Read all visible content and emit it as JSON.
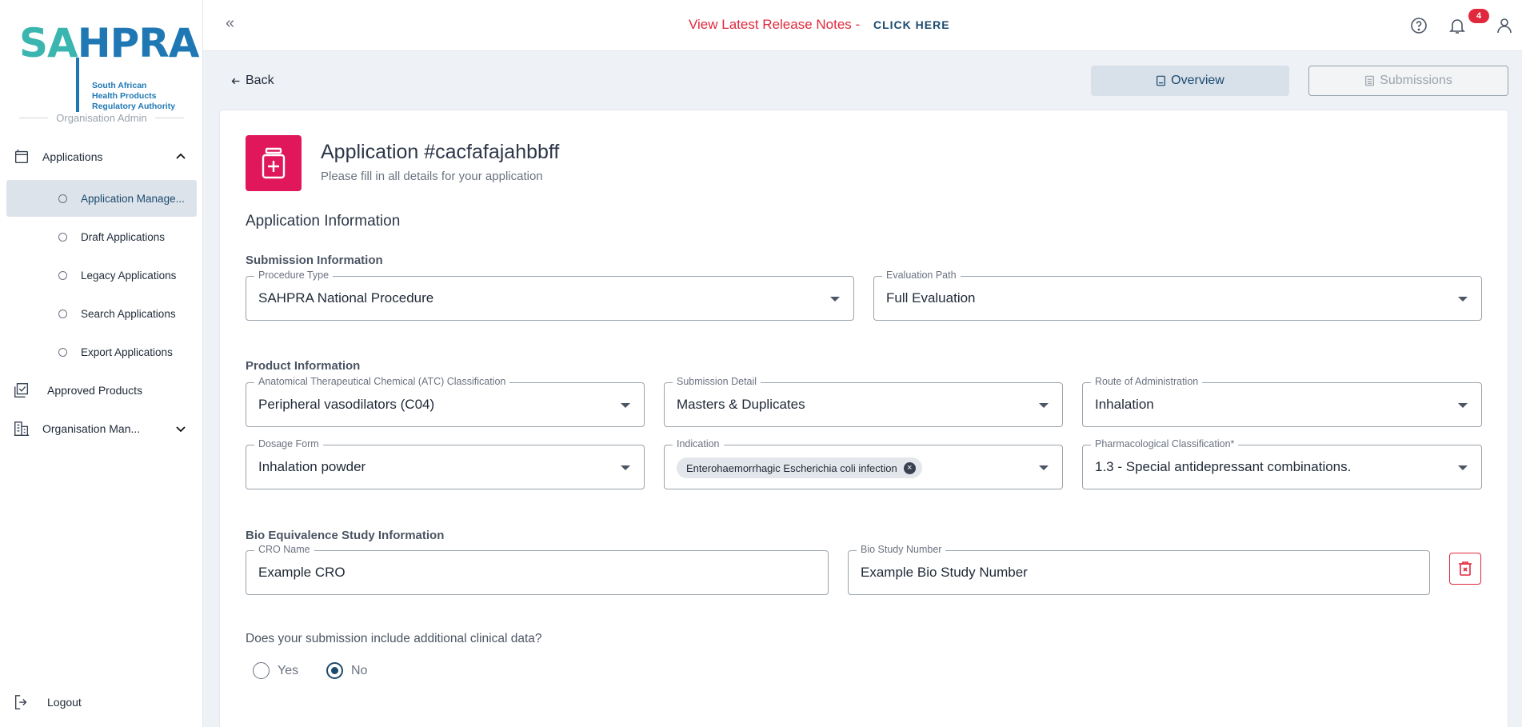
{
  "logo": {
    "brand_sa": "SA",
    "brand_hpra": "HPRA",
    "tagline_1": "South African",
    "tagline_2": "Health Products",
    "tagline_3": "Regulatory Authority"
  },
  "sidebar": {
    "section_label": "Organisation Admin",
    "applications": "Applications",
    "sub_items": [
      "Application Manage...",
      "Draft Applications",
      "Legacy Applications",
      "Search Applications",
      "Export Applications"
    ],
    "approved_products": "Approved Products",
    "organisation": "Organisation Man...",
    "logout": "Logout"
  },
  "topbar": {
    "collapse": "«",
    "release_notes": "View Latest Release Notes -",
    "click_here": "CLICK HERE",
    "notification_count": "4"
  },
  "subheader": {
    "back": "Back",
    "overview": "Overview",
    "submissions": "Submissions"
  },
  "application": {
    "title": "Application #cacfafajahbbff",
    "subtitle": "Please fill in all details for your application",
    "section": "Application Information"
  },
  "submission_info": {
    "title": "Submission Information",
    "procedure_type": {
      "label": "Procedure Type",
      "value": "SAHPRA National Procedure"
    },
    "evaluation_path": {
      "label": "Evaluation Path",
      "value": "Full Evaluation"
    }
  },
  "product_info": {
    "title": "Product Information",
    "atc": {
      "label": "Anatomical Therapeutical Chemical (ATC) Classification",
      "value": "Peripheral vasodilators (C04)"
    },
    "submission_detail": {
      "label": "Submission Detail",
      "value": "Masters & Duplicates"
    },
    "route": {
      "label": "Route of Administration",
      "value": "Inhalation"
    },
    "dosage_form": {
      "label": "Dosage Form",
      "value": "Inhalation powder"
    },
    "indication": {
      "label": "Indication",
      "chip": "Enterohaemorrhagic Escherichia coli infection"
    },
    "pharmacological": {
      "label": "Pharmacological Classification*",
      "value": "1.3 - Special antidepressant combinations."
    }
  },
  "bio_info": {
    "title": "Bio Equivalence Study Information",
    "cro_name": {
      "label": "CRO Name",
      "value": "Example CRO"
    },
    "bio_study_number": {
      "label": "Bio Study Number",
      "value": "Example Bio Study Number"
    }
  },
  "clinical": {
    "question": "Does your submission include additional clinical data?",
    "yes": "Yes",
    "no": "No",
    "selected": "No"
  },
  "colors": {
    "accent": "#1a4a6e",
    "danger": "#e0293d",
    "app_icon": "#e0175a"
  }
}
